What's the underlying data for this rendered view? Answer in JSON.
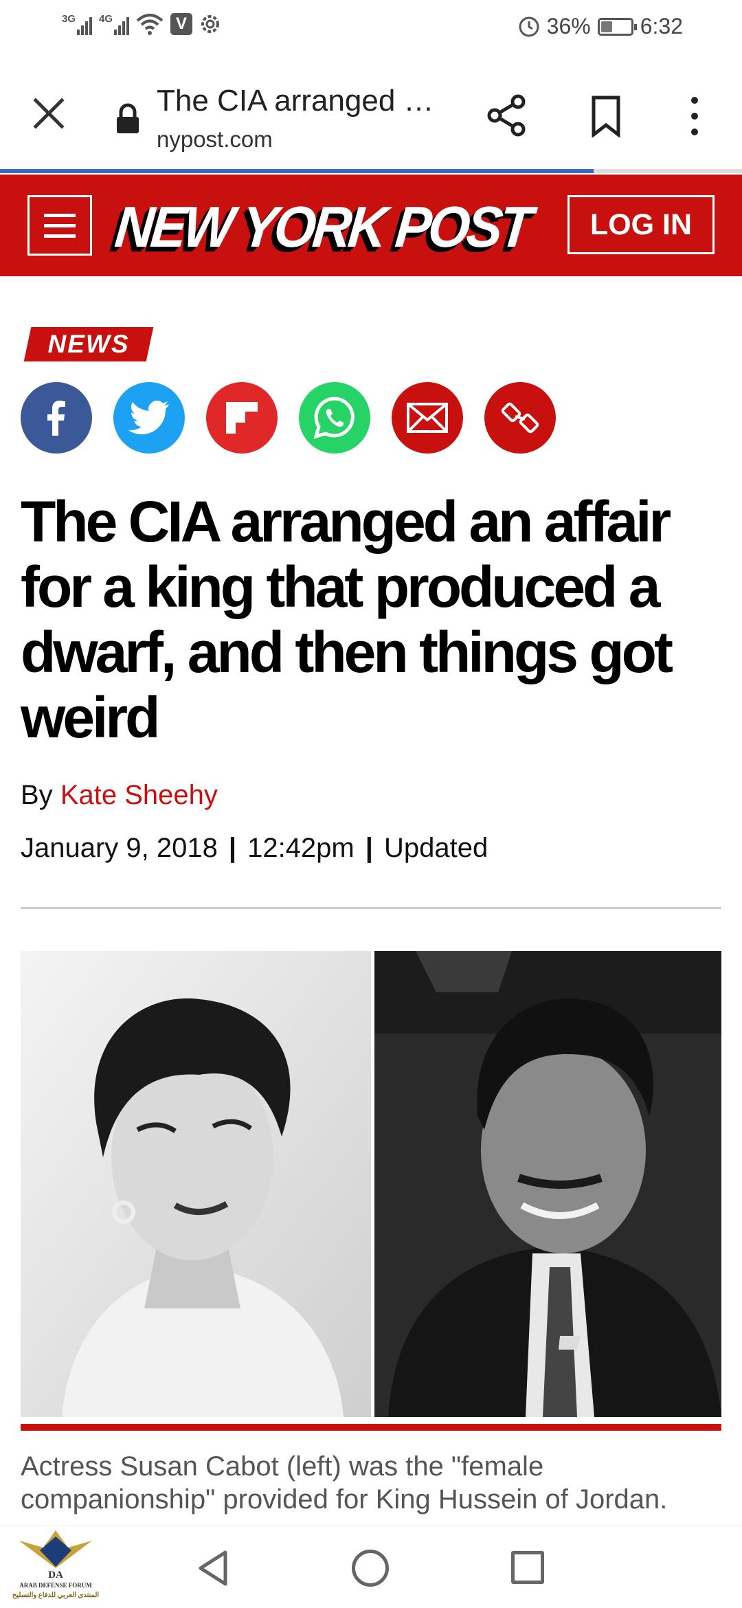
{
  "status_bar": {
    "signal1_label": "3G",
    "signal2_label": "4G",
    "vpn_badge": "V",
    "battery_percent": "36%",
    "battery_level": 0.36,
    "time": "6:32"
  },
  "browser": {
    "tab_title": "The CIA arranged …",
    "url": "nypost.com",
    "load_progress": 0.8,
    "accent_color": "#3a66c4"
  },
  "site_header": {
    "logo": "NEW YORK POST",
    "login_label": "LOG IN",
    "brand_color": "#c8100e"
  },
  "article": {
    "section_tag": "NEWS",
    "share_buttons": [
      {
        "name": "facebook-icon",
        "color": "#3b5998"
      },
      {
        "name": "twitter-icon",
        "color": "#1da1f2"
      },
      {
        "name": "flipboard-icon",
        "color": "#e12828"
      },
      {
        "name": "whatsapp-icon",
        "color": "#25d366"
      },
      {
        "name": "email-icon",
        "color": "#c8100e"
      },
      {
        "name": "link-icon",
        "color": "#c8100e"
      }
    ],
    "headline": "The CIA arranged an affair for a king that produced a dwarf, and then things got weird",
    "byline_prefix": "By",
    "author": "Kate Sheehy",
    "date": "January 9, 2018",
    "time": "12:42pm",
    "updated_label": "Updated",
    "caption": "Actress Susan Cabot (left) was the \"female companionship\" provided for King Hussein of Jordan."
  },
  "watermark": {
    "line1": "DA",
    "line2": "ARAB DEFENSE FORUM",
    "line3": "المنتدى العربي للدفاع والتسليح"
  },
  "nav_bar": {
    "icons": [
      "back-icon",
      "home-icon",
      "recents-icon"
    ]
  }
}
